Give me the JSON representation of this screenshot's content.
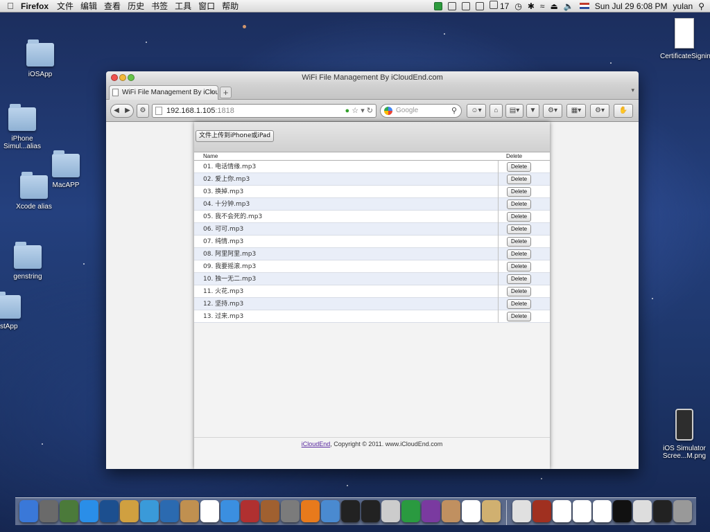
{
  "menubar": {
    "app_name": "Firefox",
    "menus": [
      "文件",
      "编辑",
      "查看",
      "历史",
      "书签",
      "工具",
      "窗口",
      "帮助"
    ],
    "battery_count": "17",
    "datetime": "Sun Jul 29  6:08 PM",
    "user": "yulan"
  },
  "desktop": {
    "icons": [
      {
        "label": "iOSApp"
      },
      {
        "label": "iPhone Simul...alias"
      },
      {
        "label": "MacAPP"
      },
      {
        "label": "Xcode alias"
      },
      {
        "label": "genstring"
      },
      {
        "label": "estApp"
      },
      {
        "label": "CertificateSigningR...quest"
      },
      {
        "label": "iOS Simulator Scree...M.png"
      }
    ]
  },
  "browser": {
    "window_title": "WiFi File Management By iCloudEnd.com",
    "tab_title": "WiFi File Management By iCloud...",
    "url_host": "192.168.1.105",
    "url_port": ":1818",
    "search_placeholder": "Google"
  },
  "page": {
    "upload_button": "文件上传到iPhone或iPad",
    "columns": {
      "name": "Name",
      "delete": "Delete"
    },
    "files": [
      {
        "name": "01. 电话情缘.mp3",
        "action": "Delete"
      },
      {
        "name": "02. 爱上你.mp3",
        "action": "Delete"
      },
      {
        "name": "03. 换掉.mp3",
        "action": "Delete"
      },
      {
        "name": "04. 十分钟.mp3",
        "action": "Delete"
      },
      {
        "name": "05. 我不会死的.mp3",
        "action": "Delete"
      },
      {
        "name": "06. 可可.mp3",
        "action": "Delete"
      },
      {
        "name": "07. 纯情.mp3",
        "action": "Delete"
      },
      {
        "name": "08. 阿里阿里.mp3",
        "action": "Delete"
      },
      {
        "name": "09. 我要摇滚.mp3",
        "action": "Delete"
      },
      {
        "name": "10. 独一无二.mp3",
        "action": "Delete"
      },
      {
        "name": "11. 火花.mp3",
        "action": "Delete"
      },
      {
        "name": "12. 坚持.mp3",
        "action": "Delete"
      },
      {
        "name": "13. 过来.mp3",
        "action": "Delete"
      }
    ],
    "footer_link": "iCloudEnd",
    "footer_text": ", Copyright © 2011. www.iCloudEnd.com"
  },
  "dock": {
    "app_colors": [
      "#3a78d8",
      "#6a6a6a",
      "#4b7a3a",
      "#2a8ee8",
      "#1c4f8f",
      "#d0a040",
      "#3a9ad9",
      "#2b6ab0",
      "#c09050",
      "#ffffff",
      "#3b8fe0",
      "#b03030",
      "#a06030",
      "#7b7b7b",
      "#e87a1c",
      "#4a8ad0",
      "#222222",
      "#222222",
      "#cccccc",
      "#2a9a40",
      "#7a3aa0",
      "#c09060",
      "#ffffff",
      "#d0b070",
      "#e0e0e0",
      "#a03020",
      "#ffffff",
      "#ffffff",
      "#ffffff",
      "#111111",
      "#dddddd",
      "#222222",
      "#999999"
    ]
  }
}
